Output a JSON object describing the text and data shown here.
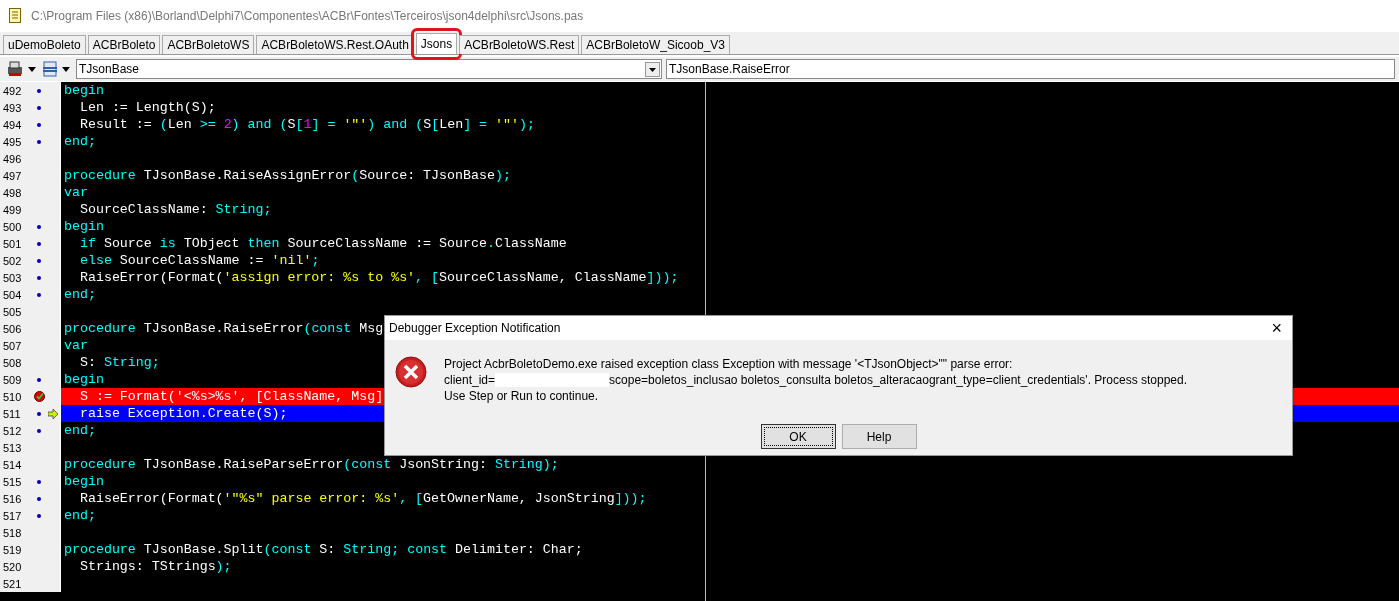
{
  "window": {
    "title": "C:\\Program Files (x86)\\Borland\\Delphi7\\Componentes\\ACBr\\Fontes\\Terceiros\\json4delphi\\src\\Jsons.pas"
  },
  "tabs": [
    {
      "label": "uDemoBoleto",
      "selected": false,
      "circled": false
    },
    {
      "label": "ACBrBoleto",
      "selected": false,
      "circled": false
    },
    {
      "label": "ACBrBoletoWS",
      "selected": false,
      "circled": false
    },
    {
      "label": "ACBrBoletoWS.Rest.OAuth",
      "selected": false,
      "circled": false
    },
    {
      "label": "Jsons",
      "selected": true,
      "circled": true
    },
    {
      "label": "ACBrBoletoWS.Rest",
      "selected": false,
      "circled": false
    },
    {
      "label": "ACBrBoletoW_Sicoob_V3",
      "selected": false,
      "circled": false
    }
  ],
  "toolbar": {
    "class_combo": "TJsonBase",
    "method_combo": "TJsonBase.RaiseError"
  },
  "lines": [
    {
      "number": "492",
      "executable": true,
      "breakpoint": false,
      "execution_point": false,
      "tokens": [
        {
          "kind": "kw",
          "text": "begin"
        }
      ]
    },
    {
      "number": "493",
      "executable": true,
      "breakpoint": false,
      "execution_point": false,
      "tokens": [
        {
          "kind": "id",
          "text": "  Len := Length(S);"
        }
      ]
    },
    {
      "number": "494",
      "executable": true,
      "breakpoint": false,
      "execution_point": false,
      "tokens": [
        {
          "kind": "id",
          "text": "  Result := "
        },
        {
          "kind": "sym",
          "text": "("
        },
        {
          "kind": "id",
          "text": "Len "
        },
        {
          "kind": "sym",
          "text": ">= "
        },
        {
          "kind": "num",
          "text": "2"
        },
        {
          "kind": "sym",
          "text": ") "
        },
        {
          "kind": "kw",
          "text": "and"
        },
        {
          "kind": "sym",
          "text": " ("
        },
        {
          "kind": "id",
          "text": "S"
        },
        {
          "kind": "sym",
          "text": "["
        },
        {
          "kind": "num",
          "text": "1"
        },
        {
          "kind": "sym",
          "text": "] = "
        },
        {
          "kind": "str",
          "text": "'\"'"
        },
        {
          "kind": "sym",
          "text": ") "
        },
        {
          "kind": "kw",
          "text": "and"
        },
        {
          "kind": "sym",
          "text": " ("
        },
        {
          "kind": "id",
          "text": "S"
        },
        {
          "kind": "sym",
          "text": "["
        },
        {
          "kind": "id",
          "text": "Len"
        },
        {
          "kind": "sym",
          "text": "] = "
        },
        {
          "kind": "str",
          "text": "'\"'"
        },
        {
          "kind": "sym",
          "text": ");"
        }
      ]
    },
    {
      "number": "495",
      "executable": true,
      "breakpoint": false,
      "execution_point": false,
      "tokens": [
        {
          "kind": "kw",
          "text": "end;"
        }
      ]
    },
    {
      "number": "496",
      "executable": false,
      "breakpoint": false,
      "execution_point": false
    },
    {
      "number": "497",
      "executable": false,
      "breakpoint": false,
      "execution_point": false,
      "tokens": [
        {
          "kind": "kw",
          "text": "procedure"
        },
        {
          "kind": "id",
          "text": " TJsonBase.RaiseAssignError"
        },
        {
          "kind": "sym",
          "text": "("
        },
        {
          "kind": "id",
          "text": "Source: TJsonBase"
        },
        {
          "kind": "sym",
          "text": ");"
        }
      ]
    },
    {
      "number": "498",
      "executable": false,
      "breakpoint": false,
      "execution_point": false,
      "tokens": [
        {
          "kind": "kw",
          "text": "var"
        }
      ]
    },
    {
      "number": "499",
      "executable": false,
      "breakpoint": false,
      "execution_point": false,
      "tokens": [
        {
          "kind": "id",
          "text": "  SourceClassName: "
        },
        {
          "kind": "kw",
          "text": "String;"
        }
      ]
    },
    {
      "number": "500",
      "executable": true,
      "breakpoint": false,
      "execution_point": false,
      "tokens": [
        {
          "kind": "kw",
          "text": "begin"
        }
      ]
    },
    {
      "number": "501",
      "executable": true,
      "breakpoint": false,
      "execution_point": false,
      "tokens": [
        {
          "kind": "kw",
          "text": "  if"
        },
        {
          "kind": "id",
          "text": " Source "
        },
        {
          "kind": "kw",
          "text": "is"
        },
        {
          "kind": "id",
          "text": " TObject "
        },
        {
          "kind": "kw",
          "text": "then"
        },
        {
          "kind": "id",
          "text": " SourceClassName := Source"
        },
        {
          "kind": "sym",
          "text": "."
        },
        {
          "kind": "id",
          "text": "ClassName"
        }
      ]
    },
    {
      "number": "502",
      "executable": true,
      "breakpoint": false,
      "execution_point": false,
      "tokens": [
        {
          "kind": "kw",
          "text": "  else"
        },
        {
          "kind": "id",
          "text": " SourceClassName := "
        },
        {
          "kind": "str",
          "text": "'nil'"
        },
        {
          "kind": "sym",
          "text": ";"
        }
      ]
    },
    {
      "number": "503",
      "executable": true,
      "breakpoint": false,
      "execution_point": false,
      "tokens": [
        {
          "kind": "id",
          "text": "  RaiseError(Format("
        },
        {
          "kind": "str",
          "text": "'assign error: %s to %s'"
        },
        {
          "kind": "sym",
          "text": ", ["
        },
        {
          "kind": "id",
          "text": "SourceClassName, ClassName"
        },
        {
          "kind": "sym",
          "text": "]));"
        }
      ]
    },
    {
      "number": "504",
      "executable": true,
      "breakpoint": false,
      "execution_point": false,
      "tokens": [
        {
          "kind": "kw",
          "text": "end;"
        }
      ]
    },
    {
      "number": "505",
      "executable": false,
      "breakpoint": false,
      "execution_point": false
    },
    {
      "number": "506",
      "executable": false,
      "breakpoint": false,
      "execution_point": false,
      "tokens": [
        {
          "kind": "kw",
          "text": "procedure"
        },
        {
          "kind": "id",
          "text": " TJsonBase.RaiseError"
        },
        {
          "kind": "sym",
          "text": "("
        },
        {
          "kind": "kw",
          "text": "const"
        },
        {
          "kind": "id",
          "text": " Msg"
        }
      ]
    },
    {
      "number": "507",
      "executable": false,
      "breakpoint": false,
      "execution_point": false,
      "tokens": [
        {
          "kind": "kw",
          "text": "var"
        }
      ]
    },
    {
      "number": "508",
      "executable": false,
      "breakpoint": false,
      "execution_point": false,
      "tokens": [
        {
          "kind": "id",
          "text": "  S: "
        },
        {
          "kind": "kw",
          "text": "String;"
        }
      ]
    },
    {
      "number": "509",
      "executable": true,
      "breakpoint": false,
      "execution_point": false,
      "tokens": [
        {
          "kind": "kw",
          "text": "begin"
        }
      ]
    },
    {
      "number": "510",
      "breakpoint": true,
      "execution_point": false,
      "tokens": [
        {
          "kind": "id",
          "text": "  S := Format('<%s>%s', [ClassName, Msg]"
        }
      ]
    },
    {
      "number": "511",
      "executable": true,
      "breakpoint": false,
      "execution_point": true,
      "tokens": [
        {
          "kind": "id",
          "text": "  raise Exception.Create(S);"
        }
      ]
    },
    {
      "number": "512",
      "executable": true,
      "breakpoint": false,
      "execution_point": false,
      "tokens": [
        {
          "kind": "kw",
          "text": "end;"
        }
      ]
    },
    {
      "number": "513",
      "executable": false,
      "breakpoint": false,
      "execution_point": false
    },
    {
      "number": "514",
      "executable": false,
      "breakpoint": false,
      "execution_point": false,
      "tokens": [
        {
          "kind": "kw",
          "text": "procedure"
        },
        {
          "kind": "id",
          "text": " TJsonBase.RaiseParseError"
        },
        {
          "kind": "sym",
          "text": "("
        },
        {
          "kind": "kw",
          "text": "const"
        },
        {
          "kind": "id",
          "text": " JsonString: "
        },
        {
          "kind": "kw",
          "text": "String"
        },
        {
          "kind": "sym",
          "text": ");"
        }
      ]
    },
    {
      "number": "515",
      "executable": true,
      "breakpoint": false,
      "execution_point": false,
      "tokens": [
        {
          "kind": "kw",
          "text": "begin"
        }
      ]
    },
    {
      "number": "516",
      "executable": true,
      "breakpoint": false,
      "execution_point": false,
      "tokens": [
        {
          "kind": "id",
          "text": "  RaiseError(Format("
        },
        {
          "kind": "str",
          "text": "'\"%s\" parse error: %s'"
        },
        {
          "kind": "sym",
          "text": ", ["
        },
        {
          "kind": "id",
          "text": "GetOwnerName, JsonString"
        },
        {
          "kind": "sym",
          "text": "]));"
        }
      ]
    },
    {
      "number": "517",
      "executable": true,
      "breakpoint": false,
      "execution_point": false,
      "tokens": [
        {
          "kind": "kw",
          "text": "end;"
        }
      ]
    },
    {
      "number": "518",
      "executable": false,
      "breakpoint": false,
      "execution_point": false
    },
    {
      "number": "519",
      "executable": false,
      "breakpoint": false,
      "execution_point": false,
      "tokens": [
        {
          "kind": "kw",
          "text": "procedure"
        },
        {
          "kind": "id",
          "text": " TJsonBase.Split"
        },
        {
          "kind": "sym",
          "text": "("
        },
        {
          "kind": "kw",
          "text": "const"
        },
        {
          "kind": "id",
          "text": " S: "
        },
        {
          "kind": "kw",
          "text": "String"
        },
        {
          "kind": "sym",
          "text": "; "
        },
        {
          "kind": "kw",
          "text": "const"
        },
        {
          "kind": "id",
          "text": " Delimiter: Char;"
        }
      ]
    },
    {
      "number": "520",
      "executable": false,
      "breakpoint": false,
      "execution_point": false,
      "tokens": [
        {
          "kind": "id",
          "text": "  Strings: TStrings"
        },
        {
          "kind": "sym",
          "text": ");"
        }
      ]
    },
    {
      "number": "521",
      "executable": false,
      "breakpoint": false,
      "execution_point": false
    }
  ],
  "dialog": {
    "title": "Debugger Exception Notification",
    "close": "×",
    "message_line_1": "Project AcbrBoletoDemo.exe raised exception class Exception with message '<TJsonObject>\"\" parse error:",
    "message_line_2_start": "client_id=",
    "redacted": true,
    "message_line_2_end": "scope=boletos_inclusao boletos_consulta boletos_alteracaogrant_type=client_credentials'. Process stopped.",
    "message_line_3": "Use Step or Run to continue.",
    "buttons": [
      {
        "label": "OK",
        "focused": true
      },
      {
        "label": "Help",
        "focused": false
      }
    ]
  }
}
